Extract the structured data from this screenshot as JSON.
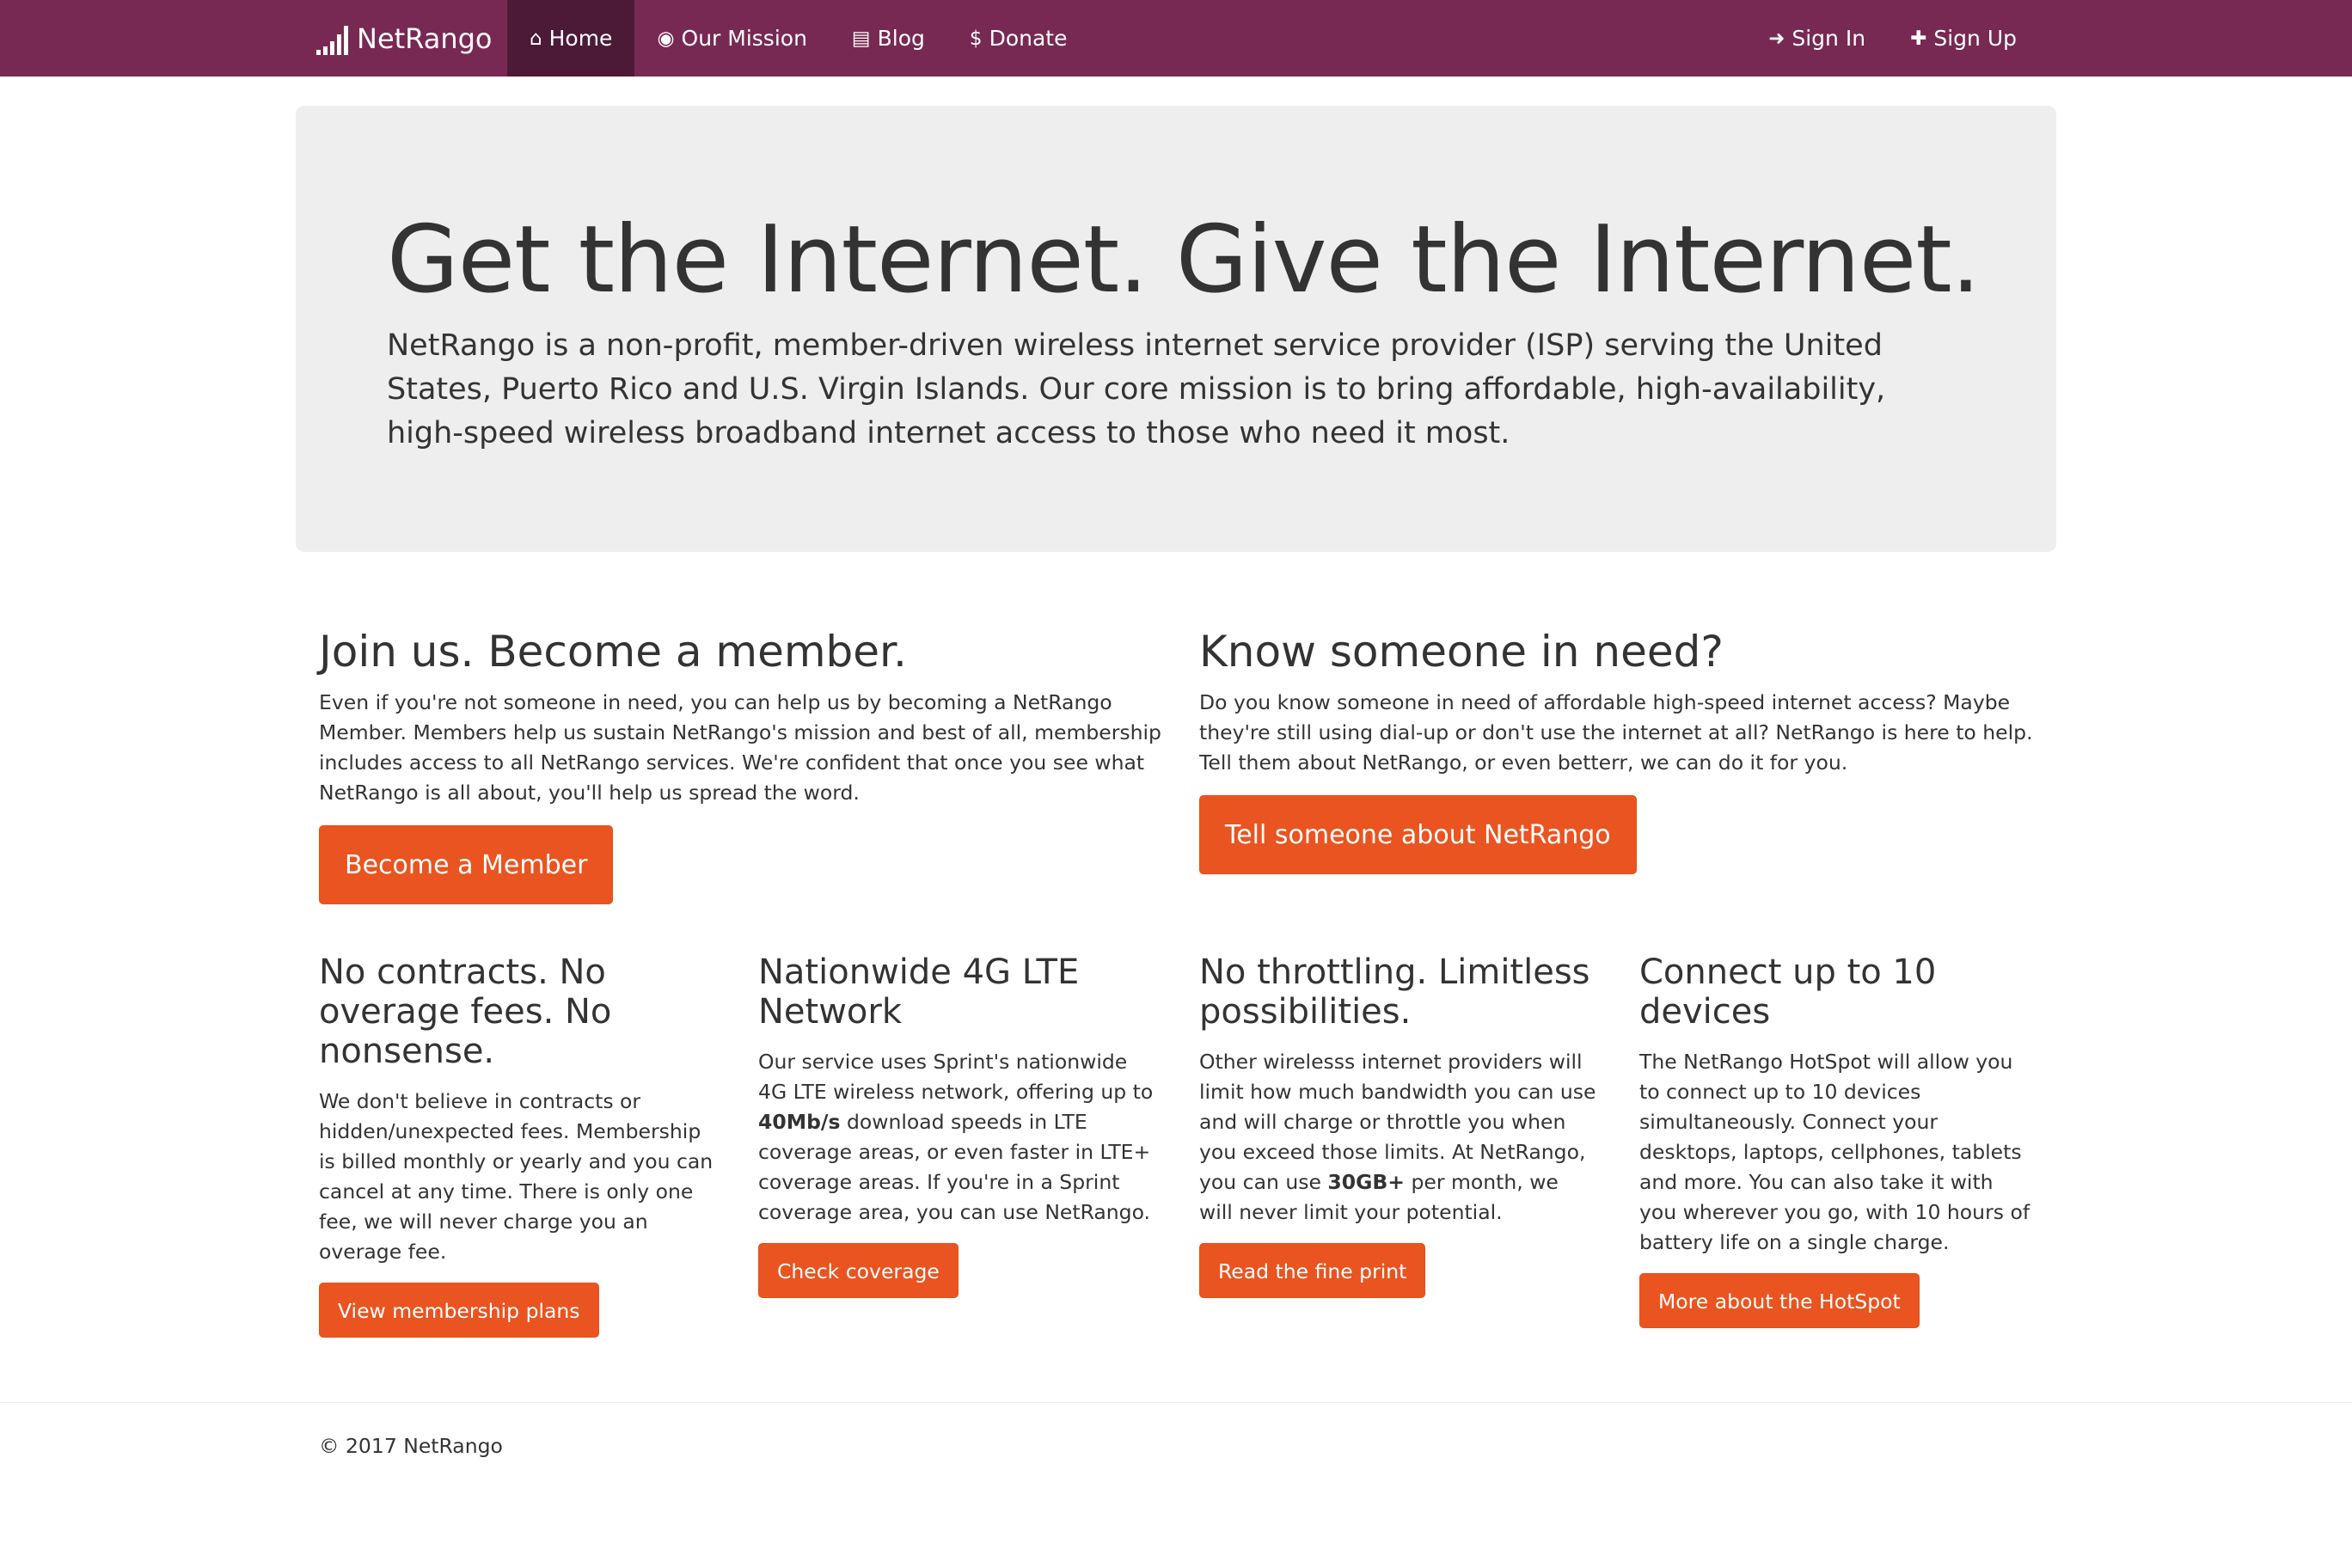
{
  "navbar": {
    "brand": "NetRango",
    "left_items": [
      {
        "icon": "home-icon",
        "glyph": "⌂",
        "label": "Home",
        "active": true
      },
      {
        "icon": "bullseye-icon",
        "glyph": "◉",
        "label": "Our Mission",
        "active": false
      },
      {
        "icon": "newspaper-icon",
        "glyph": "▤",
        "label": "Blog",
        "active": false
      },
      {
        "icon": "dollar-icon",
        "glyph": "$",
        "label": "Donate",
        "active": false
      }
    ],
    "right_items": [
      {
        "icon": "sign-in-icon",
        "glyph": "➜",
        "label": "Sign In"
      },
      {
        "icon": "user-plus-icon",
        "glyph": "✚",
        "label": "Sign Up"
      }
    ]
  },
  "jumbotron": {
    "title": "Get the Internet. Give the Internet.",
    "lead": "NetRango is a non-profit, member-driven wireless internet service provider (ISP) serving the United States, Puerto Rico and U.S. Virgin Islands. Our core mission is to bring affordable, high-availability, high-speed wireless broadband internet access to those who need it most."
  },
  "join": {
    "heading": "Join us. Become a member.",
    "text": "Even if you're not someone in need, you can help us by becoming a NetRango Member. Members help us sustain NetRango's mission and best of all, membership includes access to all NetRango services. We're confident that once you see what NetRango is all about, you'll help us spread the word.",
    "button": "Become a Member"
  },
  "need": {
    "heading": "Know someone in need?",
    "text": "Do you know someone in need of affordable high-speed internet access? Maybe they're still using dial-up or don't use the internet at all? NetRango is here to help. Tell them about NetRango, or even betterr, we can do it for you.",
    "button": "Tell someone about NetRango"
  },
  "features": [
    {
      "heading": "No contracts. No overage fees. No nonsense.",
      "text_before": "We don't believe in contracts or hidden/unexpected fees. Membership is billed monthly or yearly and you can cancel at any time. There is only one fee, we will never charge you an overage fee.",
      "bold": "",
      "text_after": "",
      "button": "View membership plans"
    },
    {
      "heading": "Nationwide 4G LTE Network",
      "text_before": "Our service uses Sprint's nationwide 4G LTE wireless network, offering up to ",
      "bold": "40Mb/s",
      "text_after": " download speeds in LTE coverage areas, or even faster in LTE+ coverage areas. If you're in a Sprint coverage area, you can use NetRango.",
      "button": "Check coverage"
    },
    {
      "heading": "No throttling. Limitless possibilities.",
      "text_before": "Other wirelesss internet providers will limit how much bandwidth you can use and will charge or throttle you when you exceed those limits. At NetRango, you can use ",
      "bold": "30GB+",
      "text_after": " per month, we will never limit your potential.",
      "button": "Read the fine print"
    },
    {
      "heading": "Connect up to 10 devices",
      "text_before": "The NetRango HotSpot will allow you to connect up to 10 devices simultaneously. Connect your desktops, laptops, cellphones, tablets and more. You can also take it with you wherever you go, with 10 hours of battery life on a single charge.",
      "bold": "",
      "text_after": "",
      "button": "More about the HotSpot"
    }
  ],
  "footer": {
    "copyright": "© 2017 NetRango"
  },
  "colors": {
    "navbar": "#772953",
    "navbar_active": "#4c1a36",
    "accent": "#e95420",
    "jumbotron": "#eeeeee"
  }
}
